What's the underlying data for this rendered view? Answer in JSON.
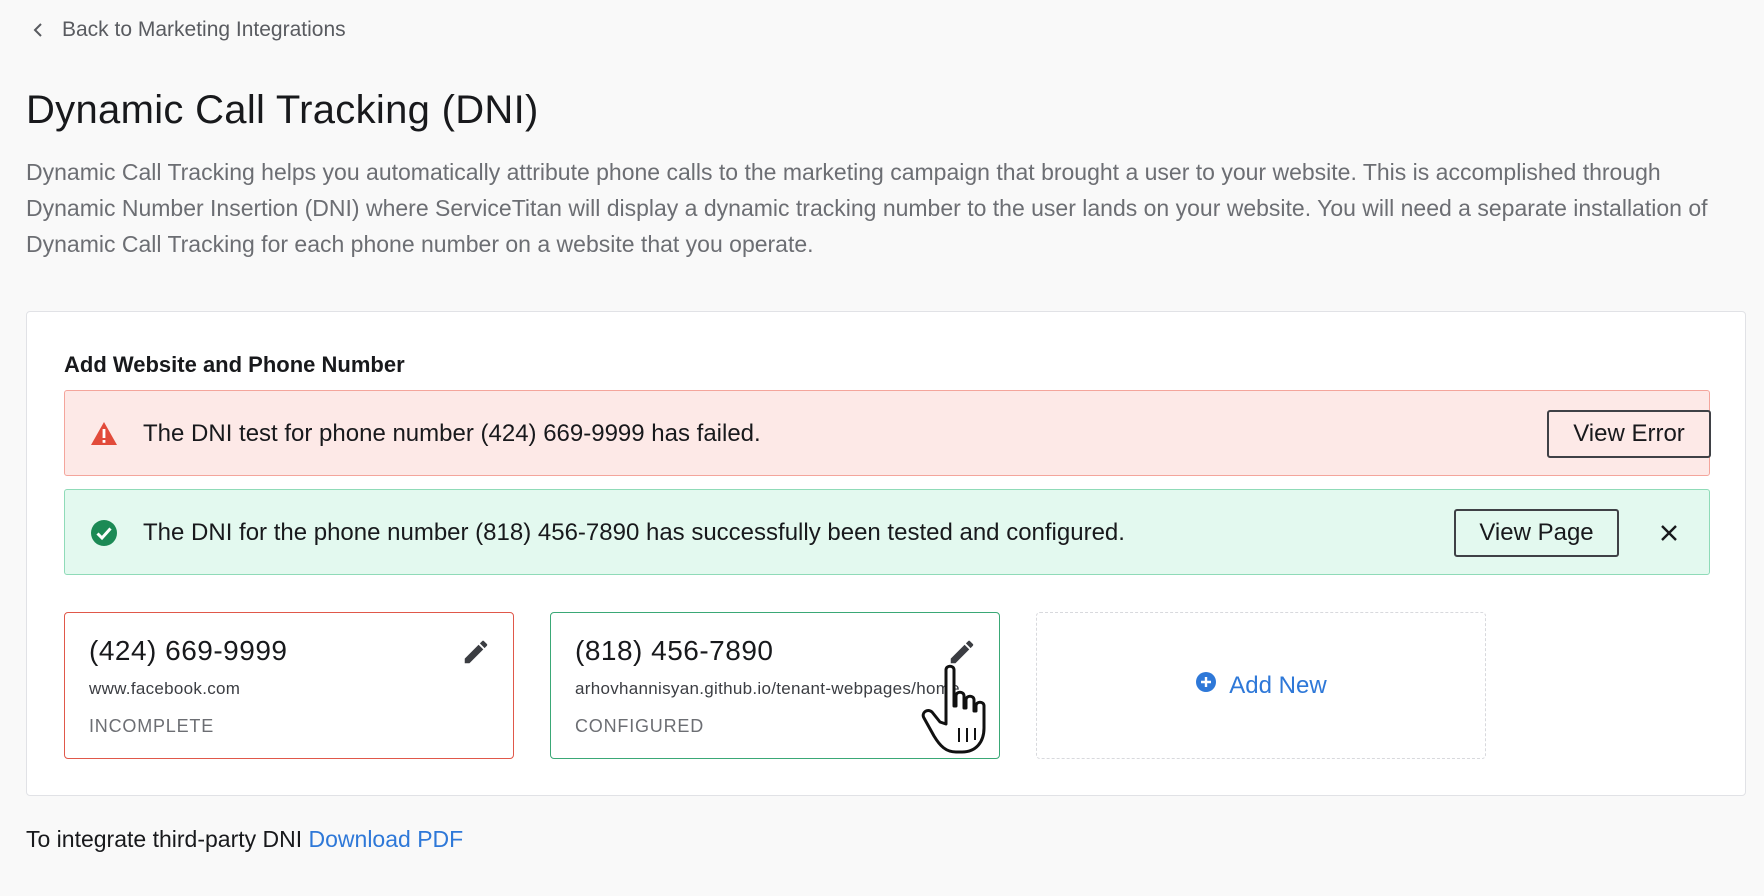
{
  "nav": {
    "back_label": "Back to Marketing Integrations"
  },
  "page": {
    "title": "Dynamic Call Tracking (DNI)",
    "description": "Dynamic Call Tracking helps you automatically attribute phone calls to the marketing campaign that brought a user to your website. This is accomplished through Dynamic Number Insertion (DNI) where ServiceTitan will display a dynamic tracking number to the user lands on your website. You will need a separate installation of Dynamic Call Tracking for each phone number on a website that you operate."
  },
  "panel": {
    "title": "Add Website and Phone Number",
    "alerts": [
      {
        "type": "error",
        "icon": "warning-triangle-icon",
        "text": "The DNI test for phone number (424) 669-9999 has failed.",
        "action_label": "View Error",
        "color": "#e24b3b"
      },
      {
        "type": "success",
        "icon": "check-circle-icon",
        "text": "The DNI for the phone number (818) 456-7890 has successfully been tested and configured.",
        "action_label": "View Page",
        "color": "#1c8a55",
        "dismissible": true
      }
    ],
    "cards": [
      {
        "phone": "(424) 669-9999",
        "site": "www.facebook.com",
        "status": "INCOMPLETE",
        "border_color": "#e0584a"
      },
      {
        "phone": "(818) 456-7890",
        "site": "arhovhannisyan.github.io/tenant-webpages/home",
        "status": "CONFIGURED",
        "border_color": "#3aa876"
      }
    ],
    "add_new_label": "Add New"
  },
  "footer": {
    "text": "To integrate third-party DNI",
    "link_label": "Download PDF"
  },
  "colors": {
    "link": "#2e78d8",
    "background": "#f9f9f9"
  }
}
